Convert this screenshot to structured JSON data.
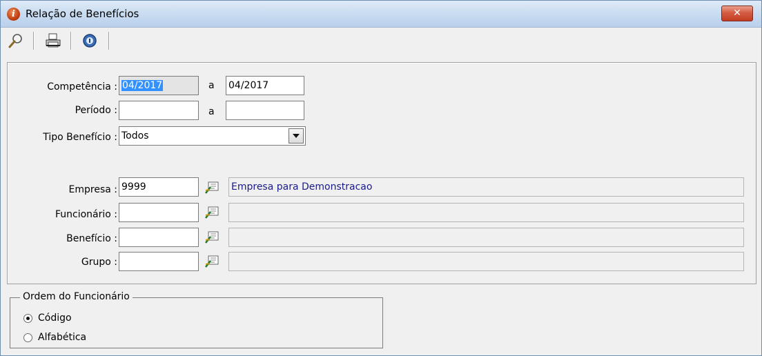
{
  "window": {
    "title": "Relação de Benefícios",
    "close_label": "✕"
  },
  "toolbar": {
    "items": [
      {
        "name": "search-icon"
      },
      {
        "name": "printer-icon"
      },
      {
        "name": "info-icon"
      }
    ]
  },
  "form": {
    "competencia": {
      "label": "Competência :",
      "from": "04/2017",
      "sep": "a",
      "to": "04/2017"
    },
    "periodo": {
      "label": "Período :",
      "from": "",
      "sep": "a",
      "to": ""
    },
    "tipo_beneficio": {
      "label": "Tipo Benefício :",
      "value": "Todos"
    },
    "empresa": {
      "label": "Empresa :",
      "code": "9999",
      "description": "Empresa para Demonstracao"
    },
    "funcionario": {
      "label": "Funcionário :",
      "code": "",
      "description": ""
    },
    "beneficio": {
      "label": "Benefício :",
      "code": "",
      "description": ""
    },
    "grupo": {
      "label": "Grupo :",
      "code": "",
      "description": ""
    }
  },
  "ordem": {
    "legend": "Ordem do Funcionário",
    "options": [
      {
        "label": "Código",
        "selected": true
      },
      {
        "label": "Alfabética",
        "selected": false
      }
    ]
  },
  "colors": {
    "titlebar": "#c9dcf1",
    "close": "#c33d22",
    "selection": "#3390ff",
    "description_text": "#1a1a8c"
  }
}
